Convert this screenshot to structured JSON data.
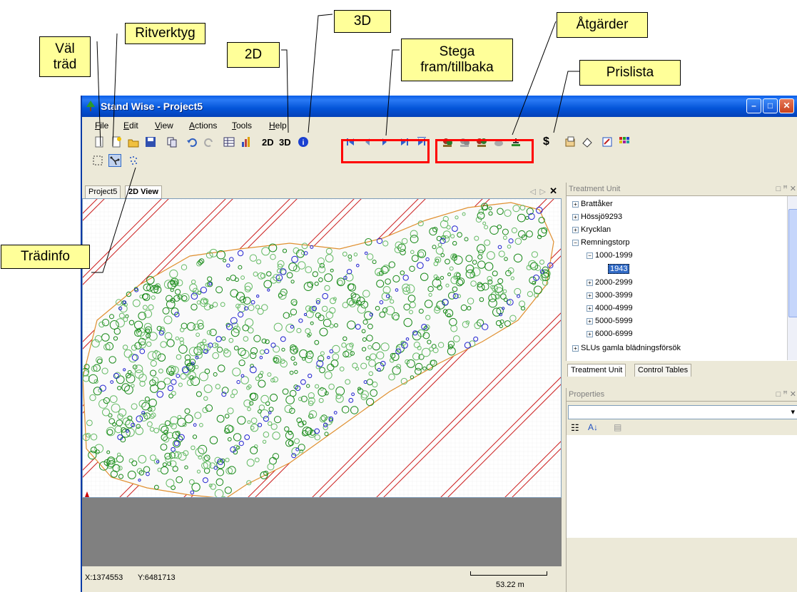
{
  "callouts": {
    "val_trad": "Väl\nträd",
    "ritverktyg": "Ritverktyg",
    "three_d": "3D",
    "two_d": "2D",
    "stega": "Stega\nfram/tillbaka",
    "atgarder": "Åtgärder",
    "prislista": "Prislista",
    "tradinfo": "Trädinfo"
  },
  "window": {
    "title": "Stand Wise - Project5"
  },
  "menu": [
    "File",
    "Edit",
    "View",
    "Actions",
    "Tools",
    "Help"
  ],
  "toolbar": {
    "label_2d": "2D",
    "label_3d": "3D",
    "price_symbol": "$"
  },
  "document_tabs": [
    "Project5",
    "2D View"
  ],
  "status": {
    "x": "X:1374553",
    "y": "Y:6481713",
    "scale": "53.22 m"
  },
  "treatment_unit": {
    "title": "Treatment Unit",
    "items": [
      "Brattåker",
      "Hössjö9293",
      "Krycklan",
      "Remningstorp"
    ],
    "child_range": "1000-1999",
    "selected": "1943",
    "ranges": [
      "2000-2999",
      "3000-3999",
      "4000-4999",
      "5000-5999",
      "6000-6999"
    ],
    "last_item": "SLUs gamla blädningsförsök",
    "tabs": [
      "Treatment Unit",
      "Control Tables"
    ]
  },
  "properties": {
    "title": "Properties"
  },
  "colors": {
    "title_blue": "#0a5ee8",
    "highlight_red": "#ff0000",
    "callout_yellow": "#ffff99",
    "tree_green": "#1a8a1a",
    "tree_blue": "#2020d0",
    "strip_red": "#cc2020",
    "boundary": "#e09030"
  }
}
